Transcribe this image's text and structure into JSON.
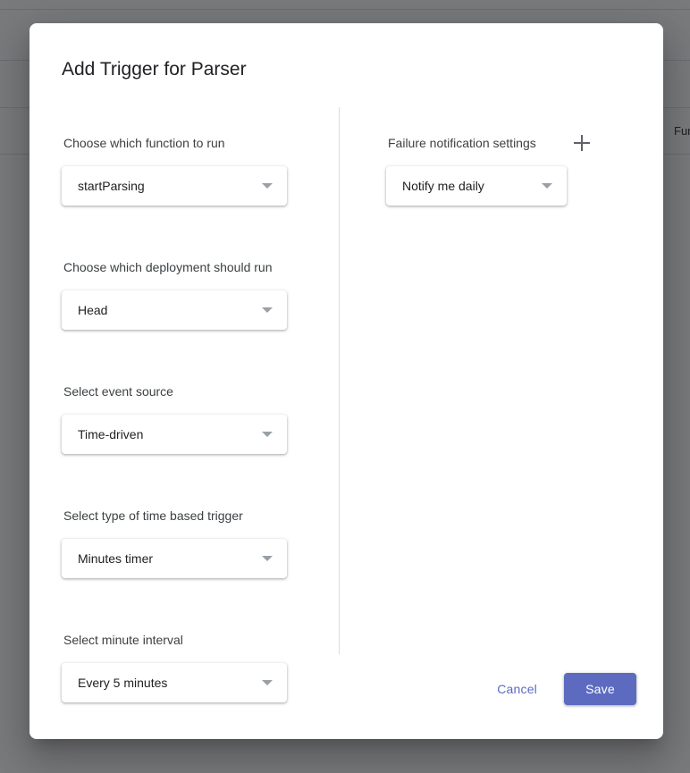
{
  "background": {
    "partial_column_header": "Fun",
    "row_divider_count": 4
  },
  "dialog": {
    "title": "Add Trigger for Parser",
    "left_column": {
      "fields": [
        {
          "label": "Choose which function to run",
          "value": "startParsing",
          "icon": "chevron-down-icon"
        },
        {
          "label": "Choose which deployment should run",
          "value": "Head",
          "icon": "chevron-down-icon"
        },
        {
          "label": "Select event source",
          "value": "Time-driven",
          "icon": "chevron-down-icon"
        },
        {
          "label": "Select type of time based trigger",
          "value": "Minutes timer",
          "icon": "chevron-down-icon"
        },
        {
          "label": "Select minute interval",
          "value": "Every 5 minutes",
          "icon": "chevron-down-icon"
        }
      ]
    },
    "right_column": {
      "heading": "Failure notification settings",
      "add_icon": "plus-icon",
      "fields": [
        {
          "label": "Failure notification settings",
          "value": "Notify me daily",
          "icon": "chevron-down-icon"
        }
      ]
    },
    "actions": {
      "cancel_label": "Cancel",
      "save_label": "Save"
    }
  },
  "colors": {
    "accent": "#5c6bc0",
    "text_primary": "#202124",
    "text_secondary": "#3c4043",
    "caret": "#9aa0a6",
    "scrim": "rgba(32,33,36,0.6)",
    "divider": "#dadce0"
  }
}
